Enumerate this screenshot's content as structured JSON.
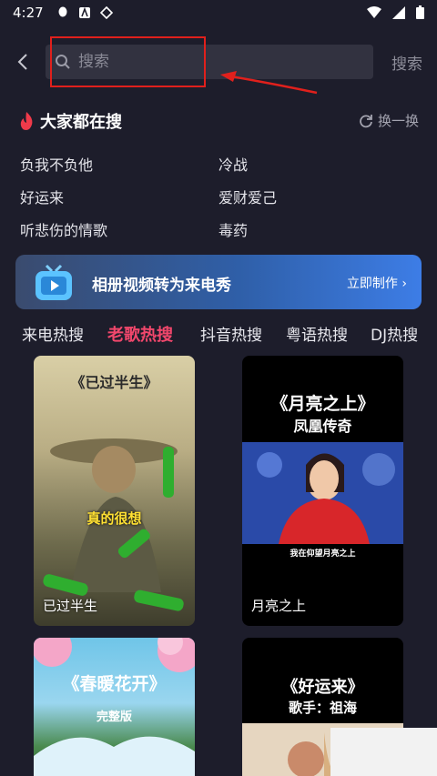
{
  "status_bar": {
    "time": "4:27"
  },
  "search": {
    "placeholder": "搜索",
    "button_label": "搜索"
  },
  "hot": {
    "title": "大家都在搜",
    "refresh_label": "换一换",
    "items": [
      "负我不负他",
      "冷战",
      "好运来",
      "爱财爱己",
      "听悲伤的情歌",
      "毒药"
    ]
  },
  "banner": {
    "text": "相册视频转为来电秀",
    "action_label": "立即制作 ›"
  },
  "tabs": [
    {
      "label": "来电热搜"
    },
    {
      "label": "老歌热搜"
    },
    {
      "label": "抖音热搜"
    },
    {
      "label": "粤语热搜"
    },
    {
      "label": "DJ热搜"
    }
  ],
  "active_tab": "老歌热搜",
  "cards": [
    {
      "label": "已过半生",
      "cover_title": "《已过半生》",
      "cover_text": "真的很想"
    },
    {
      "label": "月亮之上",
      "cover_title": "《月亮之上》",
      "cover_sub": "凤凰传奇",
      "caption": "我在仰望月亮之上"
    },
    {
      "label": "",
      "cover_title": "《春暖花开》",
      "cover_sub": "完整版"
    },
    {
      "label": "",
      "cover_title": "《好运来》",
      "cover_sub": "歌手：祖海"
    }
  ],
  "colors": {
    "accent": "#f2476c",
    "annotation": "#e0201c",
    "background": "#1d1d2b"
  }
}
